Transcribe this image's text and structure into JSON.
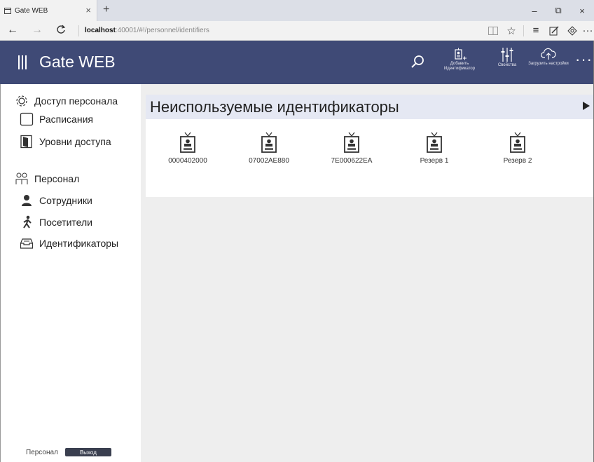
{
  "browser": {
    "tab_title": "Gate WEB",
    "tab_close": "×",
    "new_tab": "+",
    "url_host": "localhost",
    "url_rest": ":40001/#!/personnel/identifiers",
    "win_minimize": "–",
    "win_restore": "⧉",
    "win_close": "×",
    "more": "···"
  },
  "header": {
    "title": "Gate WEB",
    "actions": [
      {
        "label": "Добавить Идентификатор",
        "icon": "badge-add-icon"
      },
      {
        "label": "Свойства",
        "icon": "sliders-icon"
      },
      {
        "label": "Загрузить настройки",
        "icon": "cloud-upload-icon"
      }
    ],
    "more": "···"
  },
  "sidebar": {
    "groups": [
      {
        "label": "Доступ персонала",
        "icon": "gear-icon"
      },
      {
        "label": "Персонал",
        "icon": "people-icon"
      }
    ],
    "items": [
      {
        "label": "Расписания",
        "icon": "calendar-icon"
      },
      {
        "label": "Уровни доступа",
        "icon": "door-icon"
      },
      {
        "label": "Сотрудники",
        "icon": "employee-icon"
      },
      {
        "label": "Посетители",
        "icon": "visitor-icon"
      },
      {
        "label": "Идентификаторы",
        "icon": "card-tray-icon",
        "active": true
      }
    ],
    "footer_text": "Персонал",
    "logout_label": "Выход"
  },
  "main": {
    "title": "Неиспользуемые идентификаторы",
    "cards": [
      {
        "label": "0000402000"
      },
      {
        "label": "07002AE880"
      },
      {
        "label": "7E000622EA"
      },
      {
        "label": "Резерв 1"
      },
      {
        "label": "Резерв 2"
      }
    ]
  },
  "colors": {
    "header_bg": "#3f4a76",
    "section_header_bg": "#e5e8f3",
    "content_bg": "#eeeeee",
    "accent": "#3f4a76"
  }
}
